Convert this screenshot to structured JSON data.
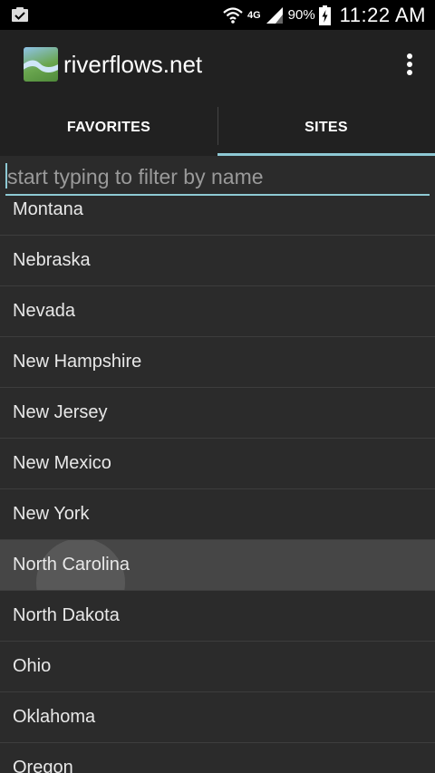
{
  "status_bar": {
    "network": "4G",
    "battery": "90%",
    "time": "11:22 AM"
  },
  "app": {
    "title": "riverflows.net"
  },
  "tabs": [
    {
      "label": "FAVORITES",
      "selected": false
    },
    {
      "label": "SITES",
      "selected": true
    }
  ],
  "filter": {
    "placeholder": "start typing to filter by name",
    "value": ""
  },
  "sites": [
    {
      "label": "Montana"
    },
    {
      "label": "Nebraska"
    },
    {
      "label": "Nevada"
    },
    {
      "label": "New Hampshire"
    },
    {
      "label": "New Jersey"
    },
    {
      "label": "New Mexico"
    },
    {
      "label": "New York"
    },
    {
      "label": "North Carolina",
      "pressed": true
    },
    {
      "label": "North Dakota"
    },
    {
      "label": "Ohio"
    },
    {
      "label": "Oklahoma"
    },
    {
      "label": "Oregon"
    }
  ],
  "colors": {
    "accent": "#8ec9d4",
    "background": "#2b2b2b",
    "action_bar": "#212121"
  },
  "icons": {
    "notification": "clipboard-check-icon",
    "wifi": "wifi-icon",
    "signal": "cell-signal-icon",
    "battery": "battery-charging-icon",
    "overflow": "more-vertical-icon"
  }
}
